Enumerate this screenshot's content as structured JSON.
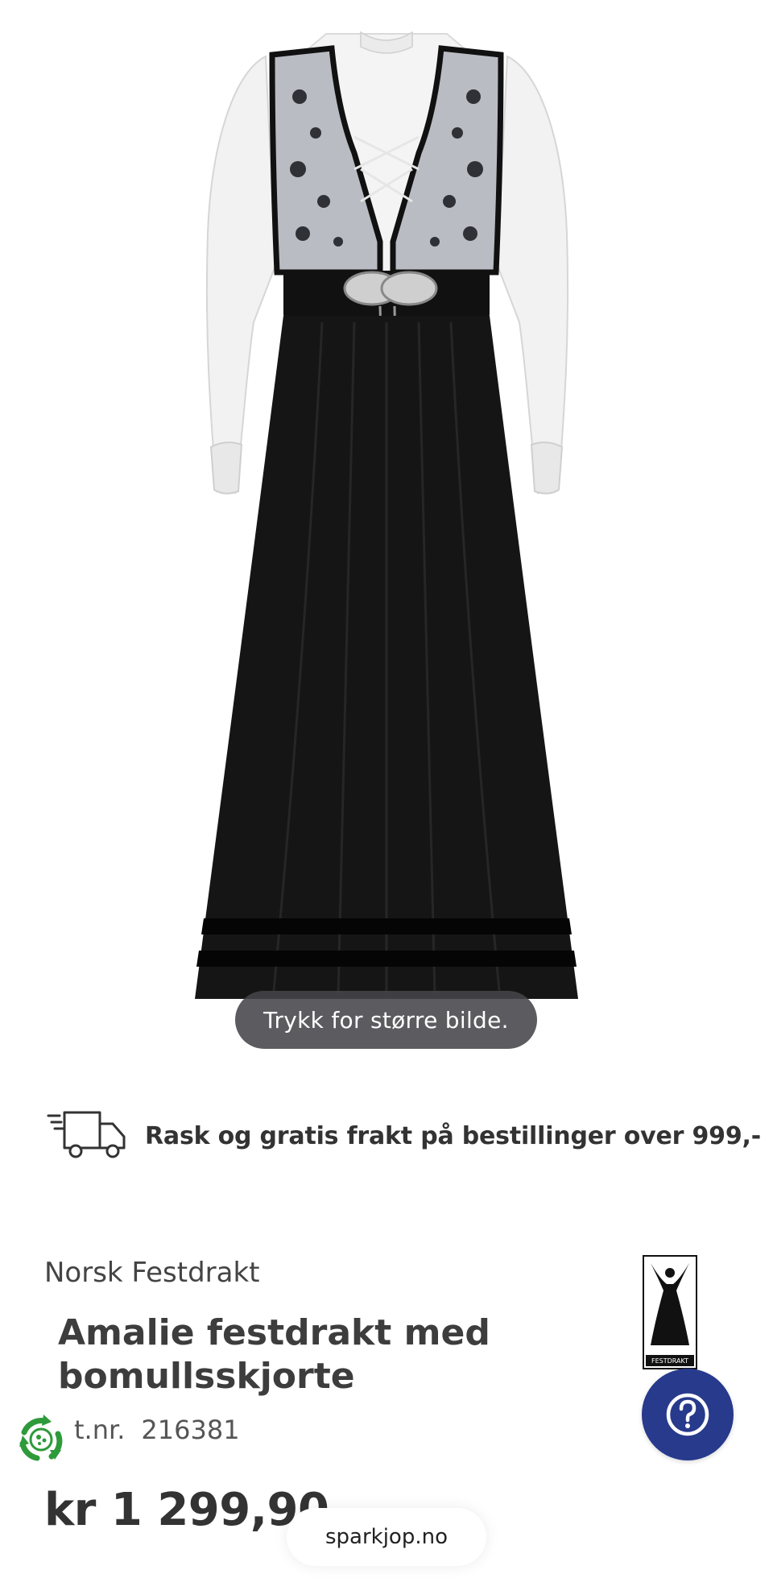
{
  "image": {
    "zoom_hint": "Trykk for større bilde."
  },
  "shipping": {
    "icon": "delivery-truck-icon",
    "text": "Rask og gratis frakt på bestillinger over 999,-"
  },
  "product": {
    "brand": "Norsk Festdrakt",
    "brand_logo_caption": "FESTDRAKT",
    "title": "Amalie festdrakt med bomullsskjorte",
    "sku_label": "t.nr.",
    "sku": "216381",
    "price": "kr 1 299,90"
  },
  "floating": {
    "help_icon": "question-mark-icon",
    "recycle_icon": "recycle-badge-icon",
    "site_label": "sparkjop.no"
  },
  "colors": {
    "help_button": "#273a8c",
    "recycle_green": "#2e9a3a",
    "dress_black": "#151515",
    "text_dark": "#3d3d3d"
  }
}
